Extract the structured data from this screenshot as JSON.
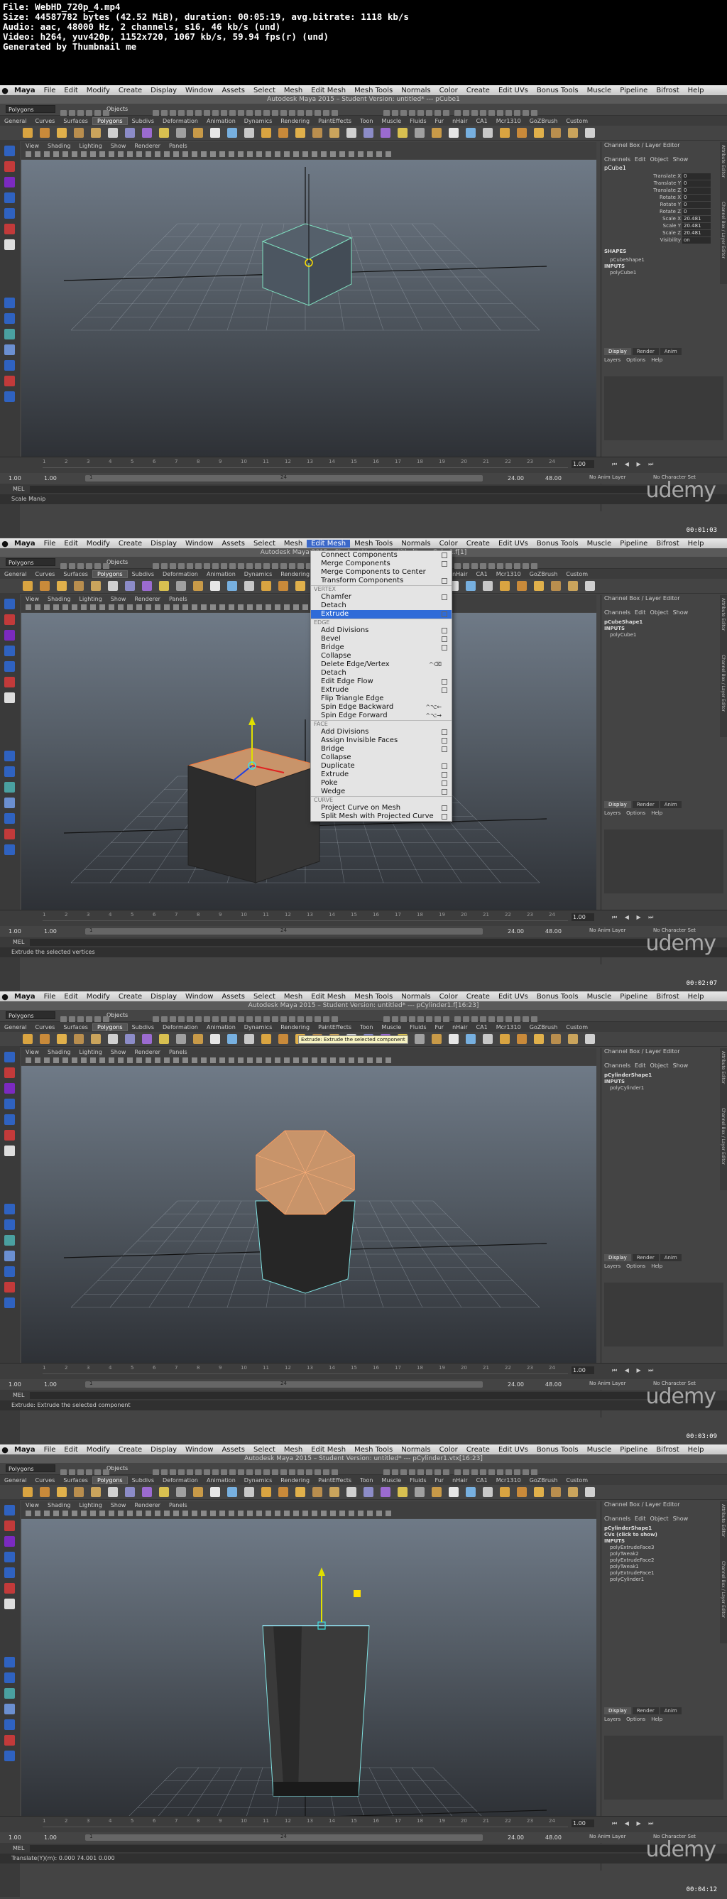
{
  "header_lines": [
    "File: WebHD_720p_4.mp4",
    "Size: 44587782 bytes (42.52 MiB), duration: 00:05:19, avg.bitrate: 1118 kb/s",
    "Audio: aac, 48000 Hz, 2 channels, s16, 46 kb/s (und)",
    "Video: h264, yuv420p, 1152x720, 1067 kb/s, 59.94 fps(r) (und)",
    "Generated by Thumbnail me"
  ],
  "menubar": [
    "Maya",
    "File",
    "Edit",
    "Modify",
    "Create",
    "Display",
    "Window",
    "Assets",
    "Select",
    "Mesh",
    "Edit Mesh",
    "Mesh Tools",
    "Normals",
    "Color",
    "Create",
    "Edit UVs",
    "Bonus Tools",
    "Muscle",
    "Pipeline",
    "Bifrost",
    "Help"
  ],
  "status": {
    "mode": "Polygons",
    "objects": "Objects"
  },
  "shelf_tabs": [
    "General",
    "Curves",
    "Surfaces",
    "Polygons",
    "Subdivs",
    "Deformation",
    "Animation",
    "Dynamics",
    "Rendering",
    "PaintEffects",
    "Toon",
    "Muscle",
    "Fluids",
    "Fur",
    "nHair",
    "CA1",
    "Mcr1310",
    "GoZBrush",
    "Custom"
  ],
  "panel_menu": [
    "View",
    "Shading",
    "Lighting",
    "Show",
    "Renderer",
    "Panels"
  ],
  "channel_box": {
    "header": "Channel Box / Layer Editor",
    "menu": [
      "Channels",
      "Edit",
      "Object",
      "Show"
    ]
  },
  "layer_editor": {
    "tabs": [
      "Display",
      "Render",
      "Anim"
    ],
    "menu": [
      "Layers",
      "Options",
      "Help"
    ]
  },
  "side_tabs": [
    "Attribute Editor",
    "Channel Box / Layer Editor"
  ],
  "time_ticks": [
    "1",
    "2",
    "3",
    "4",
    "5",
    "6",
    "7",
    "8",
    "9",
    "10",
    "11",
    "12",
    "13",
    "14",
    "15",
    "16",
    "17",
    "18",
    "19",
    "20",
    "21",
    "22",
    "23",
    "24"
  ],
  "current_frame": "1.00",
  "range": {
    "start": "1.00",
    "sub": "1.00",
    "mark_start": "1",
    "mark_end": "24",
    "end": "24.00",
    "total": "48.00"
  },
  "anim_layer": "No Anim Layer",
  "char_set": "No Character Set",
  "cmd_label": "MEL",
  "watermark": "udemy",
  "frames": [
    {
      "title": "Autodesk Maya 2015 – Student Version: untitled*   ---   pCube1",
      "active_menu": "",
      "node": "pCube1",
      "attrs": [
        {
          "n": "Translate X",
          "v": "0"
        },
        {
          "n": "Translate Y",
          "v": "0"
        },
        {
          "n": "Translate Z",
          "v": "0"
        },
        {
          "n": "Rotate X",
          "v": "0"
        },
        {
          "n": "Rotate Y",
          "v": "0"
        },
        {
          "n": "Rotate Z",
          "v": "0"
        },
        {
          "n": "Scale X",
          "v": "20.481"
        },
        {
          "n": "Scale Y",
          "v": "20.481"
        },
        {
          "n": "Scale Z",
          "v": "20.481"
        },
        {
          "n": "Visibility",
          "v": "on"
        }
      ],
      "shapes_header": "SHAPES",
      "shapes": [
        {
          "t": "pCubeShape1",
          "h": false
        },
        {
          "t": "INPUTS",
          "h": true
        },
        {
          "t": "polyCube1",
          "h": false
        }
      ],
      "help": "Scale Manip",
      "timestamp": "00:01:03"
    },
    {
      "title": "Autodesk Maya 2015 – Student Version: untitled*   ---   pCube1.f[1]",
      "active_menu": "Edit Mesh",
      "node": "",
      "attrs": [],
      "shapes_header": "",
      "shapes": [
        {
          "t": "pCubeShape1",
          "h": true
        },
        {
          "t": "INPUTS",
          "h": true
        },
        {
          "t": "polyCube1",
          "h": false
        }
      ],
      "help": "Extrude the selected vertices",
      "timestamp": "00:02:07",
      "menu_items": [
        {
          "t": "Connect Components",
          "box": true
        },
        {
          "t": "Merge Components",
          "box": true
        },
        {
          "t": "Merge Components to Center",
          "box": false
        },
        {
          "t": "Transform Components",
          "box": true
        },
        {
          "s": "VERTEX"
        },
        {
          "t": "Chamfer",
          "box": true
        },
        {
          "t": "Detach",
          "box": false
        },
        {
          "t": "Extrude",
          "box": true,
          "hl": true
        },
        {
          "s": "EDGE"
        },
        {
          "t": "Add Divisions",
          "box": true
        },
        {
          "t": "Bevel",
          "box": true
        },
        {
          "t": "Bridge",
          "box": true
        },
        {
          "t": "Collapse",
          "box": false
        },
        {
          "t": "Delete Edge/Vertex",
          "box": false,
          "kb": "^⌫"
        },
        {
          "t": "Detach",
          "box": false
        },
        {
          "t": "Edit Edge Flow",
          "box": true
        },
        {
          "t": "Extrude",
          "box": true
        },
        {
          "t": "Flip Triangle Edge",
          "box": false
        },
        {
          "t": "Spin Edge Backward",
          "box": false,
          "kb": "^⌥←"
        },
        {
          "t": "Spin Edge Forward",
          "box": false,
          "kb": "^⌥→"
        },
        {
          "s": "FACE"
        },
        {
          "t": "Add Divisions",
          "box": true
        },
        {
          "t": "Assign Invisible Faces",
          "box": true
        },
        {
          "t": "Bridge",
          "box": true
        },
        {
          "t": "Collapse",
          "box": false
        },
        {
          "t": "Duplicate",
          "box": true
        },
        {
          "t": "Extrude",
          "box": true
        },
        {
          "t": "Poke",
          "box": true
        },
        {
          "t": "Wedge",
          "box": true
        },
        {
          "s": "CURVE"
        },
        {
          "t": "Project Curve on Mesh",
          "box": true
        },
        {
          "t": "Split Mesh with Projected Curve",
          "box": true
        }
      ]
    },
    {
      "title": "Autodesk Maya 2015 – Student Version: untitled*   ---   pCylinder1.f[16:23]",
      "active_menu": "",
      "node": "",
      "attrs": [],
      "shapes_header": "",
      "shapes": [
        {
          "t": "pCylinderShape1",
          "h": true
        },
        {
          "t": "INPUTS",
          "h": true
        },
        {
          "t": "polyCylinder1",
          "h": false
        }
      ],
      "help": "Extrude: Extrude the selected component",
      "tooltip": "Extrude: Extrude the selected component",
      "timestamp": "00:03:09"
    },
    {
      "title": "Autodesk Maya 2015 – Student Version: untitled*   ---   pCylinder1.vtx[16:23]",
      "active_menu": "",
      "node": "",
      "attrs": [],
      "shapes_header": "",
      "shapes": [
        {
          "t": "pCylinderShape1",
          "h": true
        },
        {
          "t": "CVs (click to show)",
          "h": true
        },
        {
          "t": "INPUTS",
          "h": true
        },
        {
          "t": "polyExtrudeFace3",
          "h": false
        },
        {
          "t": "polyTweak2",
          "h": false
        },
        {
          "t": "polyExtrudeFace2",
          "h": false
        },
        {
          "t": "polyTweak1",
          "h": false
        },
        {
          "t": "polyExtrudeFace1",
          "h": false
        },
        {
          "t": "polyCylinder1",
          "h": false
        }
      ],
      "help": "Translate(Y)(m):     0.000     74.001     0.000",
      "timestamp": "00:04:12"
    }
  ]
}
